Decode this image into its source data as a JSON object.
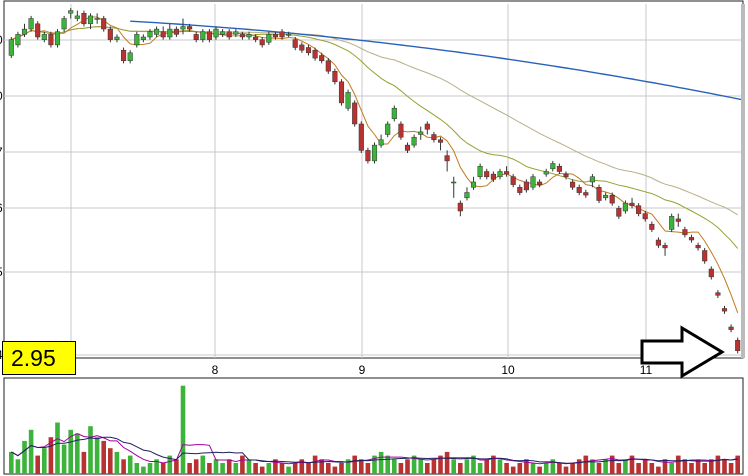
{
  "chart_data": {
    "type": "candlestick",
    "panels": [
      "price",
      "volume"
    ],
    "x_tick_labels": [
      "8",
      "9",
      "10",
      "11"
    ],
    "left_axis_labels_partial": [
      "0",
      "0",
      "7",
      "6",
      "5",
      "4",
      "3"
    ],
    "last_price_label": "2.95",
    "colors": {
      "up": "#3cb43c",
      "down": "#b83232",
      "ma_short": "#c07a20",
      "ma_mid": "#98a030",
      "ma_mid2": "#b8b088",
      "ma_long": "#2a62b8",
      "vol_ma1": "#a000a0",
      "vol_ma2": "#202060",
      "grid": "#c8c8c8",
      "frame": "#222222"
    },
    "price_range": [
      2.9,
      9.5
    ],
    "candles": [
      [
        8.6,
        8.9,
        8.55,
        8.95
      ],
      [
        8.8,
        9.0,
        8.75,
        9.05
      ],
      [
        9.0,
        9.1,
        8.95,
        9.2
      ],
      [
        9.1,
        9.3,
        9.05,
        9.35
      ],
      [
        9.2,
        8.95,
        8.9,
        9.25
      ],
      [
        8.9,
        9.0,
        8.85,
        9.05
      ],
      [
        9.0,
        8.8,
        8.75,
        9.05
      ],
      [
        8.8,
        9.05,
        8.75,
        9.1
      ],
      [
        9.1,
        9.3,
        9.05,
        9.35
      ],
      [
        9.4,
        9.45,
        9.3,
        9.5
      ],
      [
        9.3,
        9.35,
        9.25,
        9.45
      ],
      [
        9.4,
        9.2,
        9.15,
        9.45
      ],
      [
        9.2,
        9.35,
        9.1,
        9.4
      ],
      [
        9.3,
        9.3,
        9.2,
        9.4
      ],
      [
        9.3,
        9.1,
        9.05,
        9.35
      ],
      [
        9.1,
        8.9,
        8.85,
        9.15
      ],
      [
        8.9,
        8.95,
        8.85,
        9.0
      ],
      [
        8.7,
        8.5,
        8.45,
        8.75
      ],
      [
        8.5,
        8.65,
        8.45,
        8.7
      ],
      [
        8.8,
        9.0,
        8.75,
        9.05
      ],
      [
        8.9,
        8.95,
        8.85,
        9.0
      ],
      [
        8.95,
        9.05,
        8.9,
        9.1
      ],
      [
        9.0,
        9.1,
        8.95,
        9.15
      ],
      [
        9.05,
        8.95,
        8.9,
        9.15
      ],
      [
        8.95,
        9.1,
        8.9,
        9.2
      ],
      [
        9.1,
        9.0,
        8.95,
        9.15
      ],
      [
        9.1,
        9.15,
        9.0,
        9.3
      ],
      [
        9.15,
        9.1,
        9.05,
        9.2
      ],
      [
        9.0,
        8.9,
        8.85,
        9.05
      ],
      [
        8.9,
        9.05,
        8.85,
        9.1
      ],
      [
        9.05,
        8.9,
        8.85,
        9.1
      ],
      [
        8.95,
        9.1,
        8.9,
        9.15
      ],
      [
        9.0,
        9.05,
        8.95,
        9.1
      ],
      [
        9.05,
        8.95,
        8.9,
        9.1
      ],
      [
        9.0,
        9.05,
        8.95,
        9.1
      ],
      [
        9.0,
        8.95,
        8.9,
        9.05
      ],
      [
        8.95,
        9.0,
        8.9,
        9.05
      ],
      [
        8.95,
        8.9,
        8.85,
        9.0
      ],
      [
        8.9,
        8.8,
        8.75,
        8.95
      ],
      [
        8.85,
        9.0,
        8.8,
        9.05
      ],
      [
        9.0,
        8.95,
        8.9,
        9.05
      ],
      [
        9.05,
        8.95,
        8.9,
        9.1
      ],
      [
        9.0,
        9.0,
        8.95,
        9.05
      ],
      [
        8.9,
        8.75,
        8.7,
        8.95
      ],
      [
        8.8,
        8.7,
        8.65,
        8.85
      ],
      [
        8.75,
        8.65,
        8.6,
        8.8
      ],
      [
        8.7,
        8.55,
        8.5,
        8.75
      ],
      [
        8.6,
        8.5,
        8.45,
        8.65
      ],
      [
        8.5,
        8.3,
        8.25,
        8.55
      ],
      [
        8.3,
        8.1,
        8.05,
        8.35
      ],
      [
        8.1,
        7.7,
        7.65,
        8.15
      ],
      [
        7.6,
        7.9,
        7.55,
        7.95
      ],
      [
        7.7,
        7.3,
        7.25,
        7.75
      ],
      [
        7.3,
        6.8,
        6.75,
        7.35
      ],
      [
        6.8,
        6.6,
        6.55,
        6.85
      ],
      [
        6.6,
        6.9,
        6.55,
        6.95
      ],
      [
        6.9,
        7.0,
        6.85,
        7.1
      ],
      [
        7.1,
        7.3,
        7.05,
        7.35
      ],
      [
        7.4,
        7.6,
        7.35,
        7.65
      ],
      [
        7.3,
        7.05,
        7.0,
        7.35
      ],
      [
        6.9,
        6.8,
        6.75,
        6.95
      ],
      [
        6.9,
        7.05,
        6.85,
        7.1
      ],
      [
        7.1,
        7.15,
        7.0,
        7.25
      ],
      [
        7.3,
        7.2,
        7.1,
        7.35
      ],
      [
        7.1,
        7.0,
        6.95,
        7.15
      ],
      [
        7.0,
        6.95,
        6.8,
        7.05
      ],
      [
        6.7,
        6.6,
        6.4,
        6.8
      ],
      [
        6.2,
        6.2,
        5.9,
        6.3
      ],
      [
        5.8,
        5.65,
        5.55,
        5.85
      ],
      [
        5.9,
        6.0,
        5.85,
        6.1
      ],
      [
        6.1,
        6.2,
        6.05,
        6.3
      ],
      [
        6.3,
        6.5,
        6.25,
        6.55
      ],
      [
        6.4,
        6.3,
        6.25,
        6.45
      ],
      [
        6.35,
        6.25,
        6.2,
        6.4
      ],
      [
        6.3,
        6.4,
        6.25,
        6.45
      ],
      [
        6.4,
        6.35,
        6.3,
        6.5
      ],
      [
        6.3,
        6.15,
        6.1,
        6.35
      ],
      [
        6.1,
        6.0,
        5.95,
        6.15
      ],
      [
        6.2,
        6.05,
        6.0,
        6.25
      ],
      [
        6.1,
        6.3,
        6.05,
        6.35
      ],
      [
        6.2,
        6.15,
        6.1,
        6.25
      ],
      [
        6.35,
        6.4,
        6.3,
        6.45
      ],
      [
        6.45,
        6.55,
        6.4,
        6.6
      ],
      [
        6.5,
        6.4,
        6.35,
        6.55
      ],
      [
        6.35,
        6.3,
        6.25,
        6.4
      ],
      [
        6.2,
        6.1,
        6.05,
        6.25
      ],
      [
        6.1,
        6.0,
        5.95,
        6.15
      ],
      [
        6.0,
        5.95,
        5.9,
        6.05
      ],
      [
        6.2,
        6.3,
        6.1,
        6.35
      ],
      [
        6.1,
        5.85,
        5.8,
        6.15
      ],
      [
        5.9,
        5.95,
        5.85,
        6.0
      ],
      [
        5.95,
        5.8,
        5.75,
        6.0
      ],
      [
        5.7,
        5.55,
        5.5,
        5.75
      ],
      [
        5.65,
        5.8,
        5.6,
        5.85
      ],
      [
        5.8,
        5.75,
        5.7,
        5.9
      ],
      [
        5.75,
        5.6,
        5.55,
        5.8
      ],
      [
        5.6,
        5.5,
        5.45,
        5.65
      ],
      [
        5.4,
        5.3,
        5.25,
        5.45
      ],
      [
        5.1,
        5.0,
        4.95,
        5.15
      ],
      [
        5.0,
        4.95,
        4.8,
        5.05
      ],
      [
        5.3,
        5.55,
        5.25,
        5.6
      ],
      [
        5.5,
        5.45,
        5.35,
        5.6
      ],
      [
        5.3,
        5.2,
        5.15,
        5.35
      ],
      [
        5.15,
        5.1,
        5.05,
        5.2
      ],
      [
        5.0,
        4.95,
        4.9,
        5.05
      ],
      [
        4.9,
        4.7,
        4.65,
        4.95
      ],
      [
        4.55,
        4.4,
        4.35,
        4.6
      ],
      [
        4.1,
        4.05,
        4.0,
        4.15
      ],
      [
        3.8,
        3.75,
        3.7,
        3.85
      ],
      [
        3.45,
        3.4,
        3.35,
        3.5
      ],
      [
        3.2,
        3.0,
        2.95,
        3.25
      ]
    ],
    "volume": [
      30,
      20,
      45,
      60,
      25,
      35,
      50,
      70,
      40,
      60,
      55,
      30,
      65,
      50,
      45,
      35,
      30,
      20,
      25,
      15,
      10,
      15,
      20,
      15,
      25,
      20,
      120,
      15,
      20,
      25,
      15,
      20,
      15,
      20,
      15,
      25,
      20,
      15,
      10,
      15,
      20,
      15,
      10,
      15,
      20,
      15,
      25,
      20,
      15,
      10,
      15,
      20,
      25,
      20,
      15,
      25,
      30,
      25,
      20,
      15,
      20,
      25,
      20,
      15,
      20,
      25,
      30,
      20,
      15,
      20,
      25,
      15,
      20,
      25,
      20,
      15,
      10,
      15,
      20,
      15,
      10,
      15,
      20,
      15,
      10,
      15,
      20,
      25,
      20,
      15,
      20,
      25,
      15,
      20,
      25,
      15,
      20,
      15,
      10,
      20,
      15,
      25,
      20,
      15,
      20,
      15,
      20,
      25,
      20,
      15,
      25
    ]
  }
}
